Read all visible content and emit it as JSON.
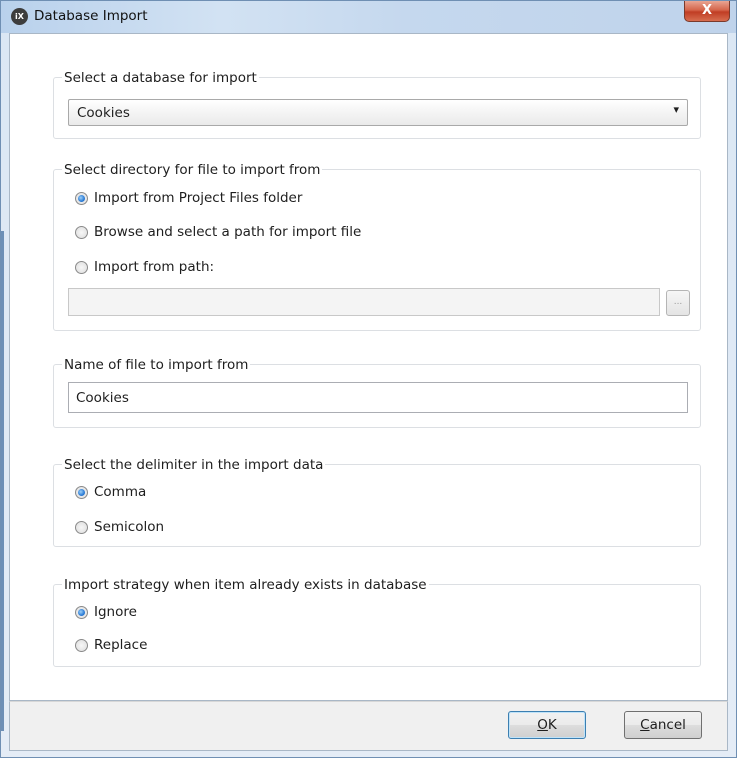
{
  "window": {
    "title": "Database Import",
    "icon_text": "iX",
    "close_glyph": "X"
  },
  "database_group": {
    "title": "Select a database for import",
    "selected": "Cookies",
    "arrow_glyph": "▾"
  },
  "directory_group": {
    "title": "Select directory for file to import from",
    "options": [
      {
        "label": "Import from Project Files folder",
        "checked": true
      },
      {
        "label": "Browse and select a path for import file",
        "checked": false
      },
      {
        "label": "Import from path:",
        "checked": false
      }
    ],
    "path_value": "",
    "browse_label": "..."
  },
  "filename_group": {
    "title": "Name of file to import from",
    "value": "Cookies"
  },
  "delimiter_group": {
    "title": "Select the delimiter in the import data",
    "options": [
      {
        "label": "Comma",
        "checked": true
      },
      {
        "label": "Semicolon",
        "checked": false
      }
    ]
  },
  "strategy_group": {
    "title": "Import strategy when item already exists in database",
    "options": [
      {
        "label": "Ignore",
        "checked": true
      },
      {
        "label": "Replace",
        "checked": false
      }
    ]
  },
  "buttons": {
    "ok_mnemonic": "O",
    "ok_rest": "K",
    "cancel_mnemonic": "C",
    "cancel_rest": "ancel"
  }
}
